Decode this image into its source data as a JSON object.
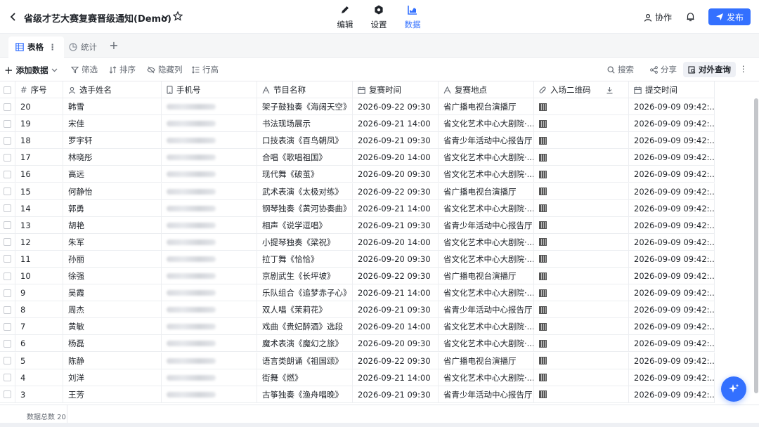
{
  "header": {
    "title": "省级才艺大赛复赛晋级通知(Demo)",
    "modes": [
      {
        "label": "编辑",
        "icon": "pen-icon"
      },
      {
        "label": "设置",
        "icon": "settings-icon"
      },
      {
        "label": "数据",
        "icon": "chart-icon"
      }
    ],
    "active_mode": "数据",
    "collab_label": "协作",
    "publish_label": "发布",
    "accent_color": "#3370ff"
  },
  "views": {
    "tabs": [
      {
        "label": "表格",
        "icon": "table-icon"
      },
      {
        "label": "统计",
        "icon": "stats-icon"
      }
    ]
  },
  "toolbar": {
    "add_label": "添加数据",
    "filter_label": "筛选",
    "sort_label": "排序",
    "hide_label": "隐藏列",
    "row_height_label": "行高",
    "search_label": "搜索",
    "share_label": "分享",
    "query_label": "对外查询"
  },
  "table": {
    "columns": [
      {
        "label": "序号",
        "icon": "hash-icon"
      },
      {
        "label": "选手姓名",
        "icon": "person-icon"
      },
      {
        "label": "手机号",
        "icon": "phone-icon"
      },
      {
        "label": "节目名称",
        "icon": "text-icon"
      },
      {
        "label": "复赛时间",
        "icon": "calendar-icon"
      },
      {
        "label": "复赛地点",
        "icon": "text-icon"
      },
      {
        "label": "入场二维码",
        "icon": "attachment-icon"
      },
      {
        "label": "提交时间",
        "icon": "calendar-icon"
      }
    ],
    "rows": [
      {
        "no": "20",
        "name": "韩雪",
        "program": "架子鼓独奏《海阔天空》",
        "time": "2026-09-22 09:30",
        "venue": "省广播电视台演播厅",
        "submitted": "2026-09-09 09:42:..."
      },
      {
        "no": "19",
        "name": "宋佳",
        "program": "书法现场展示",
        "time": "2026-09-21 14:00",
        "venue": "省文化艺术中心大剧院·...",
        "submitted": "2026-09-09 09:42:..."
      },
      {
        "no": "18",
        "name": "罗宇轩",
        "program": "口技表演《百鸟朝凤》",
        "time": "2026-09-21 09:30",
        "venue": "省青少年活动中心报告厅",
        "submitted": "2026-09-09 09:42:..."
      },
      {
        "no": "17",
        "name": "林晓彤",
        "program": "合唱《歌唱祖国》",
        "time": "2026-09-20 14:00",
        "venue": "省文化艺术中心大剧院·...",
        "submitted": "2026-09-09 09:42:..."
      },
      {
        "no": "16",
        "name": "高远",
        "program": "现代舞《破茧》",
        "time": "2026-09-20 09:30",
        "venue": "省文化艺术中心大剧院·...",
        "submitted": "2026-09-09 09:42:..."
      },
      {
        "no": "15",
        "name": "何静怡",
        "program": "武术表演《太极对练》",
        "time": "2026-09-22 09:30",
        "venue": "省广播电视台演播厅",
        "submitted": "2026-09-09 09:42:..."
      },
      {
        "no": "14",
        "name": "郭勇",
        "program": "钢琴独奏《黄河协奏曲》",
        "time": "2026-09-21 14:00",
        "venue": "省文化艺术中心大剧院·...",
        "submitted": "2026-09-09 09:42:..."
      },
      {
        "no": "13",
        "name": "胡艳",
        "program": "相声《说学逗唱》",
        "time": "2026-09-21 09:30",
        "venue": "省青少年活动中心报告厅",
        "submitted": "2026-09-09 09:42:..."
      },
      {
        "no": "12",
        "name": "朱军",
        "program": "小提琴独奏《梁祝》",
        "time": "2026-09-20 14:00",
        "venue": "省文化艺术中心大剧院·...",
        "submitted": "2026-09-09 09:42:..."
      },
      {
        "no": "11",
        "name": "孙丽",
        "program": "拉丁舞《恰恰》",
        "time": "2026-09-20 09:30",
        "venue": "省文化艺术中心大剧院·...",
        "submitted": "2026-09-09 09:42:..."
      },
      {
        "no": "10",
        "name": "徐强",
        "program": "京剧武生《长坪坡》",
        "time": "2026-09-22 09:30",
        "venue": "省广播电视台演播厅",
        "submitted": "2026-09-09 09:42:..."
      },
      {
        "no": "9",
        "name": "吴霞",
        "program": "乐队组合《追梦赤子心》",
        "time": "2026-09-21 14:00",
        "venue": "省文化艺术中心大剧院·...",
        "submitted": "2026-09-09 09:42:..."
      },
      {
        "no": "8",
        "name": "周杰",
        "program": "双人唱《茉莉花》",
        "time": "2026-09-21 09:30",
        "venue": "省青少年活动中心报告厅",
        "submitted": "2026-09-09 09:42:..."
      },
      {
        "no": "7",
        "name": "黄敏",
        "program": "戏曲《贵妃醉酒》选段",
        "time": "2026-09-20 14:00",
        "venue": "省文化艺术中心大剧院·...",
        "submitted": "2026-09-09 09:42:..."
      },
      {
        "no": "6",
        "name": "杨磊",
        "program": "魔术表演《魔幻之旅》",
        "time": "2026-09-20 09:30",
        "venue": "省文化艺术中心大剧院·...",
        "submitted": "2026-09-09 09:42:..."
      },
      {
        "no": "5",
        "name": "陈静",
        "program": "语言类朗诵《祖国颂》",
        "time": "2026-09-22 09:30",
        "venue": "省广播电视台演播厅",
        "submitted": "2026-09-09 09:42:..."
      },
      {
        "no": "4",
        "name": "刘洋",
        "program": "街舞《燃》",
        "time": "2026-09-21 14:00",
        "venue": "省文化艺术中心大剧院·...",
        "submitted": "2026-09-09 09:42:..."
      },
      {
        "no": "3",
        "name": "王芳",
        "program": "古筝独奏《渔舟唱晚》",
        "time": "2026-09-21 09:30",
        "venue": "省青少年活动中心报告厅",
        "submitted": "2026-09-09 09:42:..."
      }
    ]
  },
  "footer": {
    "count_label": "数据总数 20"
  }
}
